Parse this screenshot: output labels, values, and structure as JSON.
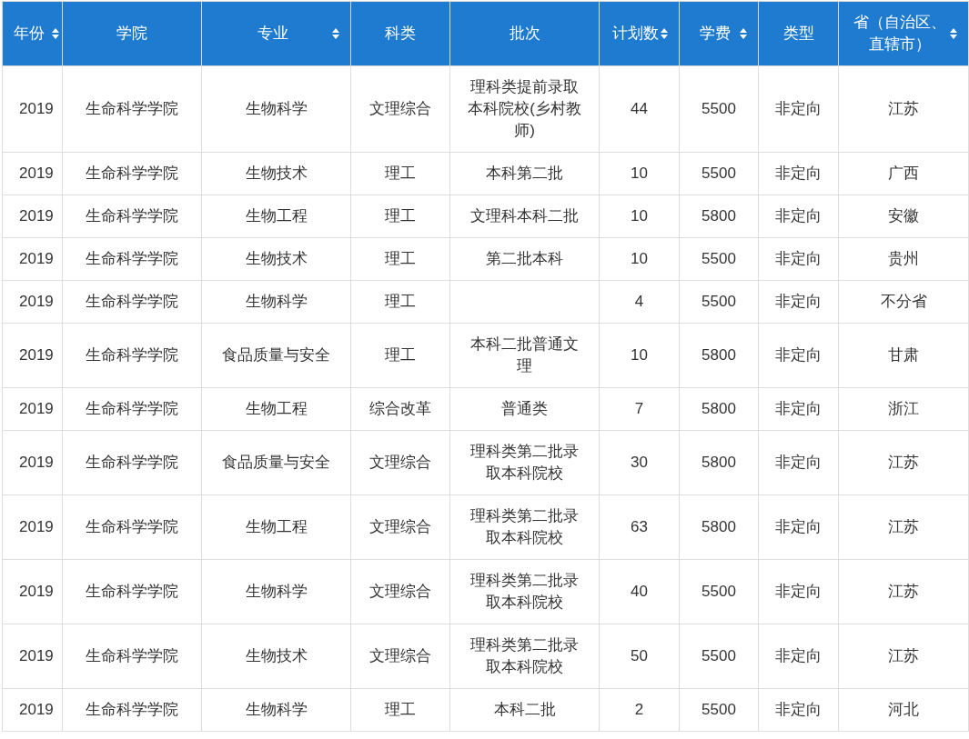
{
  "table": {
    "columns": [
      {
        "label": "年份",
        "sortable": true
      },
      {
        "label": "学院",
        "sortable": false
      },
      {
        "label": "专业",
        "sortable": true
      },
      {
        "label": "科类",
        "sortable": false
      },
      {
        "label": "批次",
        "sortable": false
      },
      {
        "label": "计划数",
        "sortable": true
      },
      {
        "label": "学费",
        "sortable": true
      },
      {
        "label": "类型",
        "sortable": false
      },
      {
        "label": "省（自治区、直辖市）",
        "sortable": true
      }
    ],
    "rows": [
      [
        "2019",
        "生命科学学院",
        "生物科学",
        "文理综合",
        "理科类提前录取本科院校(乡村教师)",
        "44",
        "5500",
        "非定向",
        "江苏"
      ],
      [
        "2019",
        "生命科学学院",
        "生物技术",
        "理工",
        "本科第二批",
        "10",
        "5500",
        "非定向",
        "广西"
      ],
      [
        "2019",
        "生命科学学院",
        "生物工程",
        "理工",
        "文理科本科二批",
        "10",
        "5800",
        "非定向",
        "安徽"
      ],
      [
        "2019",
        "生命科学学院",
        "生物技术",
        "理工",
        "第二批本科",
        "10",
        "5500",
        "非定向",
        "贵州"
      ],
      [
        "2019",
        "生命科学学院",
        "生物科学",
        "理工",
        null,
        "4",
        "5500",
        "非定向",
        "不分省"
      ],
      [
        "2019",
        "生命科学学院",
        "食品质量与安全",
        "理工",
        "本科二批普通文理",
        "10",
        "5800",
        "非定向",
        "甘肃"
      ],
      [
        "2019",
        "生命科学学院",
        "生物工程",
        "综合改革",
        "普通类",
        "7",
        "5800",
        "非定向",
        "浙江"
      ],
      [
        "2019",
        "生命科学学院",
        "食品质量与安全",
        "文理综合",
        "理科类第二批录取本科院校",
        "30",
        "5800",
        "非定向",
        "江苏"
      ],
      [
        "2019",
        "生命科学学院",
        "生物工程",
        "文理综合",
        "理科类第二批录取本科院校",
        "63",
        "5800",
        "非定向",
        "江苏"
      ],
      [
        "2019",
        "生命科学学院",
        "生物科学",
        "文理综合",
        "理科类第二批录取本科院校",
        "40",
        "5500",
        "非定向",
        "江苏"
      ],
      [
        "2019",
        "生命科学学院",
        "生物技术",
        "文理综合",
        "理科类第二批录取本科院校",
        "50",
        "5500",
        "非定向",
        "江苏"
      ],
      [
        "2019",
        "生命科学学院",
        "生物科学",
        "理工",
        "本科二批",
        "2",
        "5500",
        "非定向",
        "河北"
      ]
    ]
  }
}
